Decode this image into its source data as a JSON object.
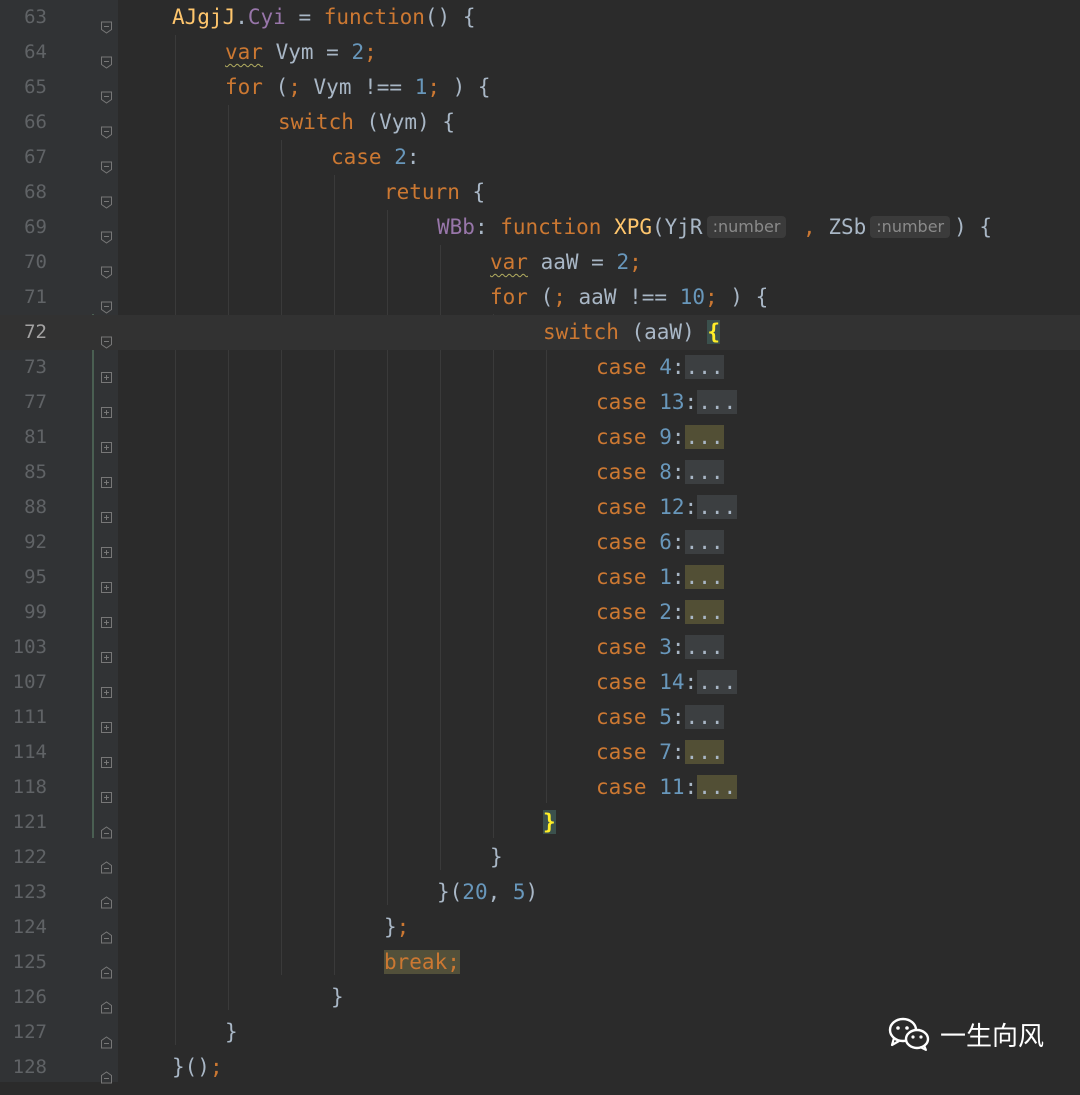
{
  "editor": {
    "current_line": "72",
    "lines": [
      {
        "ln": "63"
      },
      {
        "ln": "64"
      },
      {
        "ln": "65"
      },
      {
        "ln": "66"
      },
      {
        "ln": "67"
      },
      {
        "ln": "68"
      },
      {
        "ln": "69",
        "hint1": ":number",
        "hint2": ":number"
      },
      {
        "ln": "70"
      },
      {
        "ln": "71"
      },
      {
        "ln": "72"
      },
      {
        "ln": "73",
        "case": "4"
      },
      {
        "ln": "77",
        "case": "13"
      },
      {
        "ln": "81",
        "case": "9"
      },
      {
        "ln": "85",
        "case": "8"
      },
      {
        "ln": "88",
        "case": "12"
      },
      {
        "ln": "92",
        "case": "6"
      },
      {
        "ln": "95",
        "case": "1"
      },
      {
        "ln": "99",
        "case": "2"
      },
      {
        "ln": "103",
        "case": "3"
      },
      {
        "ln": "107",
        "case": "14"
      },
      {
        "ln": "111",
        "case": "5"
      },
      {
        "ln": "114",
        "case": "7"
      },
      {
        "ln": "118",
        "case": "11"
      },
      {
        "ln": "121"
      },
      {
        "ln": "122"
      },
      {
        "ln": "123"
      },
      {
        "ln": "124"
      },
      {
        "ln": "125"
      },
      {
        "ln": "126"
      },
      {
        "ln": "127"
      },
      {
        "ln": "128"
      }
    ]
  },
  "code": {
    "l63": {
      "obj": "AJgjJ",
      "dot": ".",
      "prop": "Cyi",
      "eq": " = ",
      "kw": "function",
      "tail": "() {"
    },
    "l64": {
      "kw": "var",
      "mid": " Vym = ",
      "num": "2",
      "semi": ";"
    },
    "l65": {
      "kw": "for",
      "a": " (",
      "semi1": ";",
      "b": " Vym !== ",
      "num": "1",
      "semi2": ";",
      "c": " ) {"
    },
    "l66": {
      "kw": "switch",
      "rest": " (Vym) {"
    },
    "l67": {
      "kw": "case",
      "sp": " ",
      "num": "2",
      "colon": ":"
    },
    "l68": {
      "kw": "return",
      "rest": " {"
    },
    "l69": {
      "prop": "WBb",
      "colon": ": ",
      "kw": "function",
      "sp": " ",
      "fn": "XPG",
      "p1": "(YjR",
      "comma": " , ",
      "p2": "ZSb",
      "tail": ") {"
    },
    "l70": {
      "kw": "var",
      "mid": " aaW = ",
      "num": "2",
      "semi": ";"
    },
    "l71": {
      "kw": "for",
      "a": " (",
      "semi1": ";",
      "b": " aaW !== ",
      "num": "10",
      "semi2": ";",
      "c": " ) {"
    },
    "l72": {
      "kw": "switch",
      "rest": " (aaW) ",
      "brace": "{"
    },
    "case_kw": "case",
    "fold": "...",
    "l121": {
      "brace": "}"
    },
    "l122": {
      "t": "}"
    },
    "l123": {
      "a": "}(",
      "n1": "20",
      "comma": ", ",
      "n2": "5",
      "b": ")"
    },
    "l124": {
      "t": "}",
      "semi": ";"
    },
    "l125": {
      "kw": "break",
      "semi": ";"
    },
    "l126": {
      "t": "}"
    },
    "l127": {
      "t": "}"
    },
    "l128": {
      "t": "}()",
      "semi": ";"
    }
  },
  "watermark": {
    "text": "一生向风",
    "icon": "wechat-icon"
  }
}
